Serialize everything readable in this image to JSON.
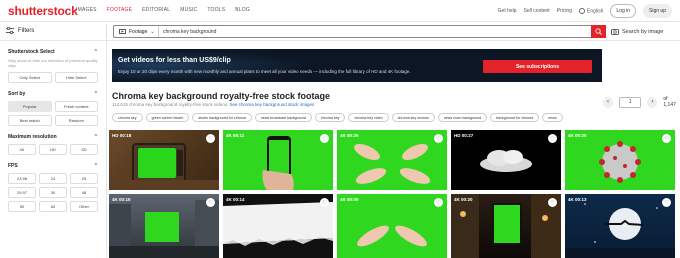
{
  "logo": "shutterstock",
  "nav": {
    "items": [
      "IMAGES",
      "FOOTAGE",
      "EDITORIAL",
      "MUSIC",
      "TOOLS",
      "BLOG"
    ],
    "right": {
      "help": "Get help",
      "sell": "Sell content",
      "pricing": "Pricing",
      "language": "English",
      "login": "Log in",
      "signup": "Sign up"
    }
  },
  "search": {
    "filters_label": "Filters",
    "type": "Footage",
    "query": "chroma key background",
    "image_search": "Search by image"
  },
  "sidebar": {
    "select_title": "Shutterstock Select",
    "select_desc": "Only show or hide our selection of premium quality clips",
    "select_options": [
      "Only Select",
      "Hide Select"
    ],
    "sort_title": "Sort by",
    "sort_options": [
      "Popular",
      "Fresh content",
      "Best match",
      "Random"
    ],
    "res_title": "Maximum resolution",
    "res_options": [
      "4K",
      "HD",
      "SD"
    ],
    "fps_title": "FPS",
    "fps_options": [
      "23.98",
      "24",
      "25",
      "29.97",
      "30",
      "48",
      "50",
      "60",
      "Other"
    ]
  },
  "banner": {
    "title": "Get videos for less than US$9/clip",
    "text": "Enjoy 10 or 20 clips every month with new monthly and annual plans to meet all your video needs — including the full library of HD and 4K footage.",
    "button": "See subscriptions"
  },
  "results": {
    "title": "Chroma key background royalty-free stock footage",
    "count_text": "114,615 chroma key background royalty-free stock videos.",
    "link_text": "See chroma key background stock images",
    "page": "1",
    "total_pages": "of 1,147"
  },
  "chips": [
    "chroma key",
    "green screen beach",
    "studio background for chroma",
    "news broadcast background",
    "chroma key",
    "chroma key video",
    "chroma key woman",
    "news room background",
    "background for chroma",
    "news"
  ],
  "thumbnails": [
    {
      "res": "HD",
      "duration": "00:18",
      "subject": "old television with green screen"
    },
    {
      "res": "4K",
      "duration": "00:11",
      "subject": "hand holding phone with green screen"
    },
    {
      "res": "4K",
      "duration": "00:26",
      "subject": "hands clapping on green background"
    },
    {
      "res": "HD",
      "duration": "00:27",
      "subject": "cloud on black background"
    },
    {
      "res": "4K",
      "duration": "00:20",
      "subject": "coronavirus on green background"
    },
    {
      "res": "4K",
      "duration": "00:15",
      "subject": "city street with green billboard"
    },
    {
      "res": "4K",
      "duration": "00:14",
      "subject": "paper tear transition"
    },
    {
      "res": "4K",
      "duration": "00:09",
      "subject": "hands on green background"
    },
    {
      "res": "4K",
      "duration": "00:20",
      "subject": "night street with green billboard"
    },
    {
      "res": "4K",
      "duration": "00:13",
      "subject": "santa sleigh over moon"
    }
  ],
  "colors": {
    "brand": "#e4222a",
    "link": "#2a6bc1",
    "banner_bg": "#0c1624"
  }
}
